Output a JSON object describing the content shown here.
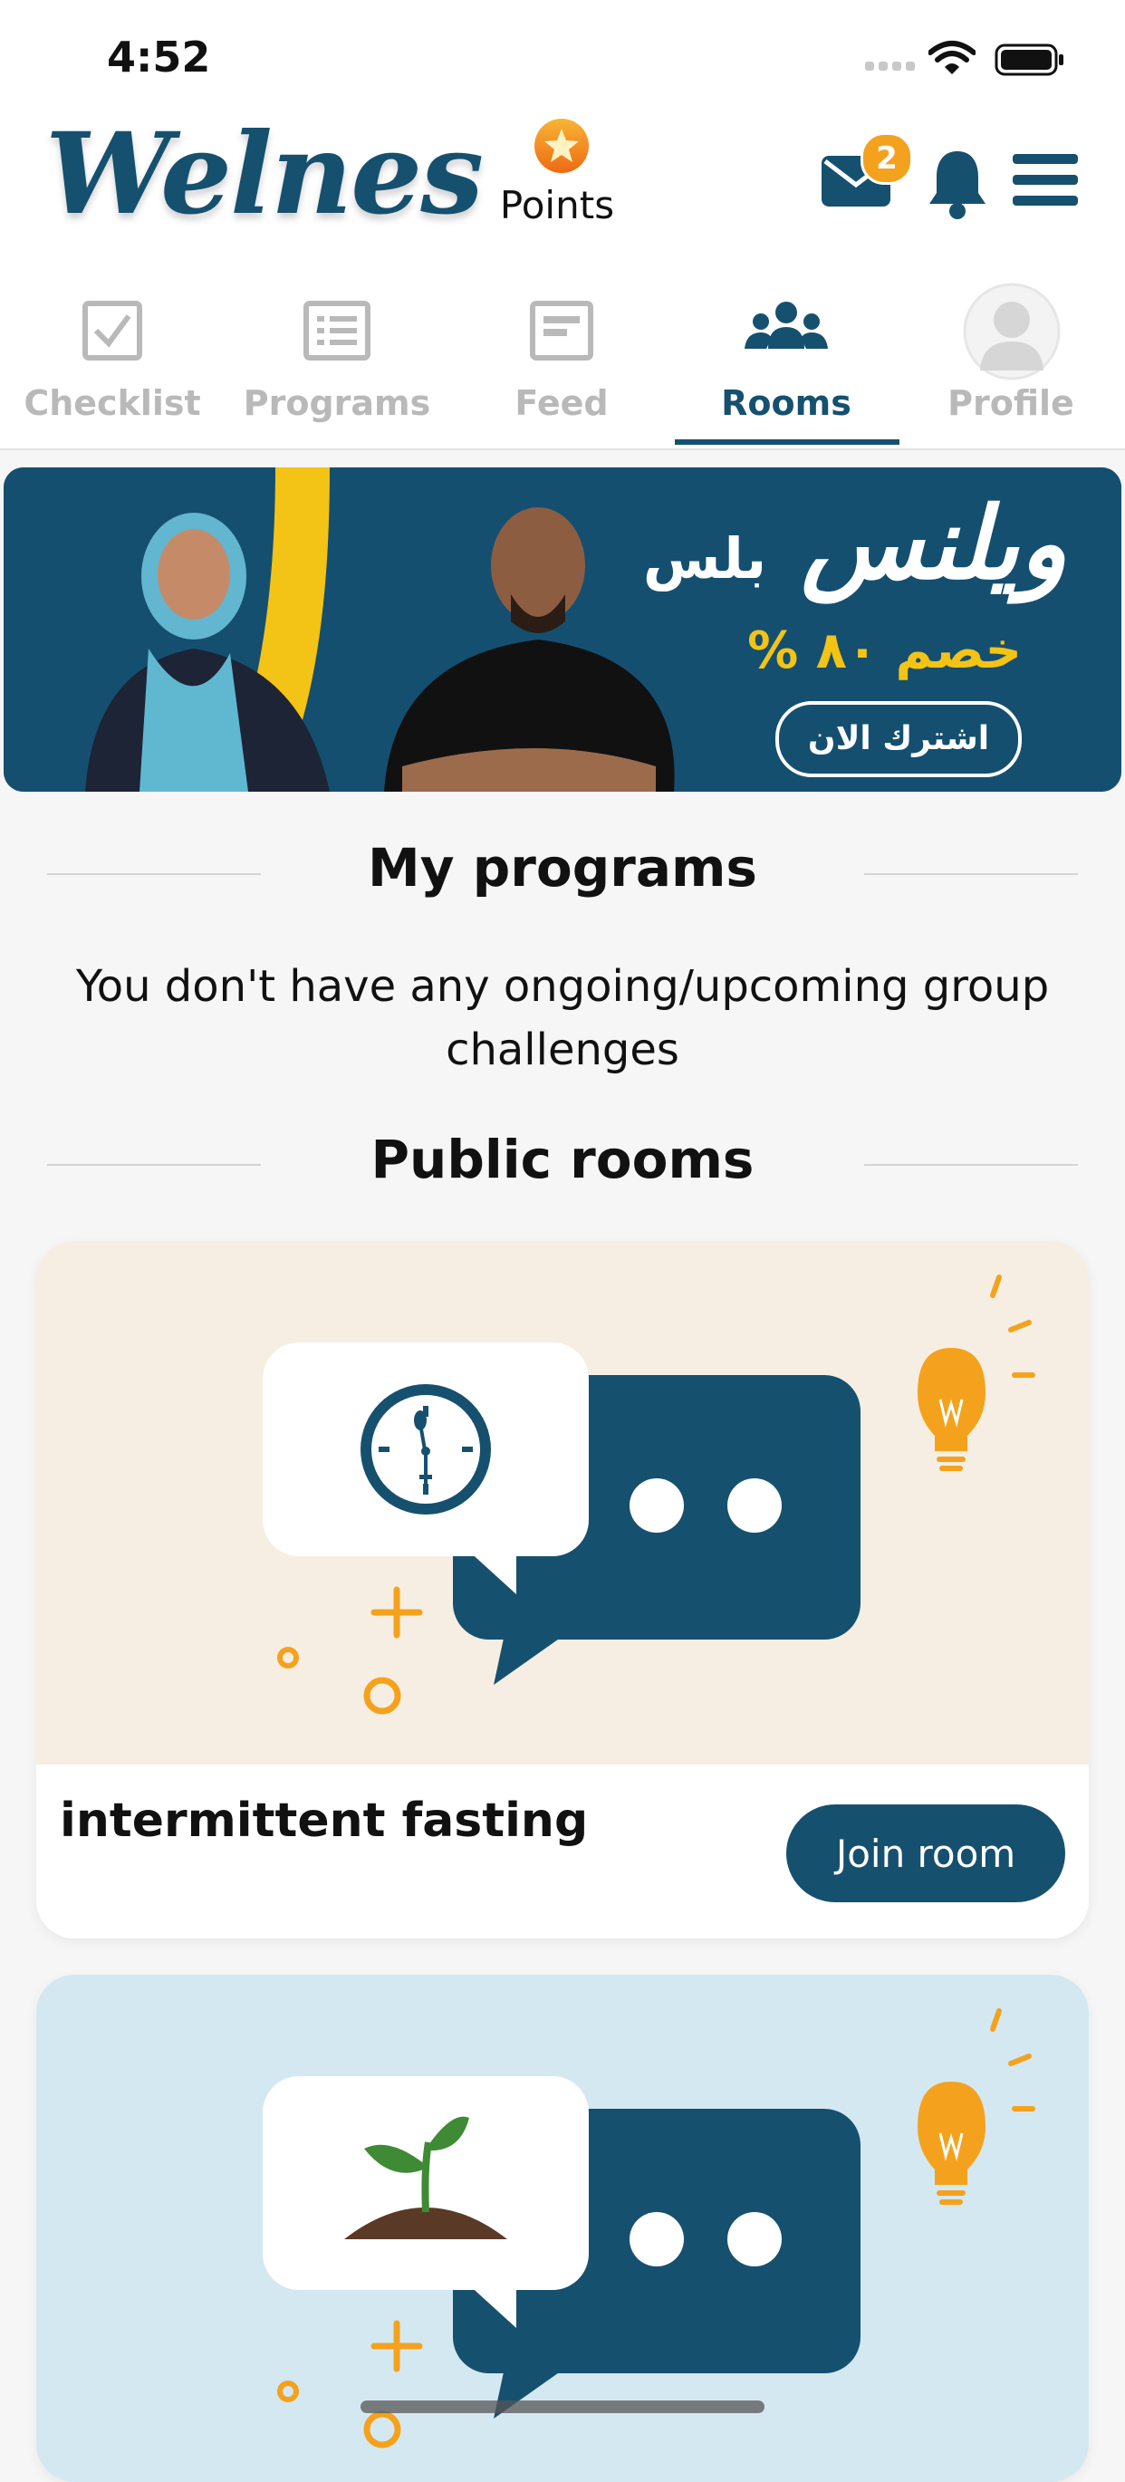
{
  "status_bar": {
    "time": "4:52"
  },
  "header": {
    "logo_text": "Welnes",
    "points_label": "Points",
    "mail_badge_count": "2"
  },
  "tabs": [
    {
      "label": "Checklist",
      "icon": "checklist-icon",
      "active": false
    },
    {
      "label": "Programs",
      "icon": "programs-icon",
      "active": false
    },
    {
      "label": "Feed",
      "icon": "feed-icon",
      "active": false
    },
    {
      "label": "Rooms",
      "icon": "rooms-icon",
      "active": true
    },
    {
      "label": "Profile",
      "icon": "avatar-icon",
      "active": false
    }
  ],
  "banner": {
    "brand_ar": "ويلنس",
    "plus_ar": "بلس",
    "discount_ar": "خصم ٨٠ %",
    "cta_ar": "اشترك الان"
  },
  "my_programs": {
    "title": "My programs",
    "empty_text": "You don't have any ongoing/upcoming group challenges"
  },
  "public_rooms": {
    "title": "Public rooms",
    "rooms": [
      {
        "title": "intermittent fasting",
        "join_label": "Join room",
        "bg_color": "#f6eee2",
        "illustration": "clock-icon"
      },
      {
        "title": "",
        "join_label": "",
        "bg_color": "#d4e8f1",
        "illustration": "sprout-icon"
      }
    ]
  },
  "colors": {
    "brand": "#16506f",
    "accent": "#f4a21d",
    "muted": "#b9b9b9"
  }
}
